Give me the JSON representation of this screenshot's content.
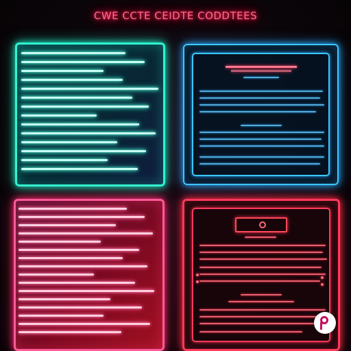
{
  "header": {
    "title": "CWE CCTE CEIDTE CODDTEES"
  },
  "colors": {
    "teal": "#2ff5d0",
    "blue": "#3ac8ff",
    "magenta": "#ff5a9a",
    "red": "#ff3a5a"
  },
  "panels": [
    {
      "name": "panel-top-left",
      "style": "teal-bars"
    },
    {
      "name": "panel-top-right",
      "style": "blue-document"
    },
    {
      "name": "panel-bottom-left",
      "style": "magenta-bars"
    },
    {
      "name": "panel-bottom-right",
      "style": "red-document"
    }
  ],
  "logo": {
    "icon": "p-logo-icon"
  }
}
